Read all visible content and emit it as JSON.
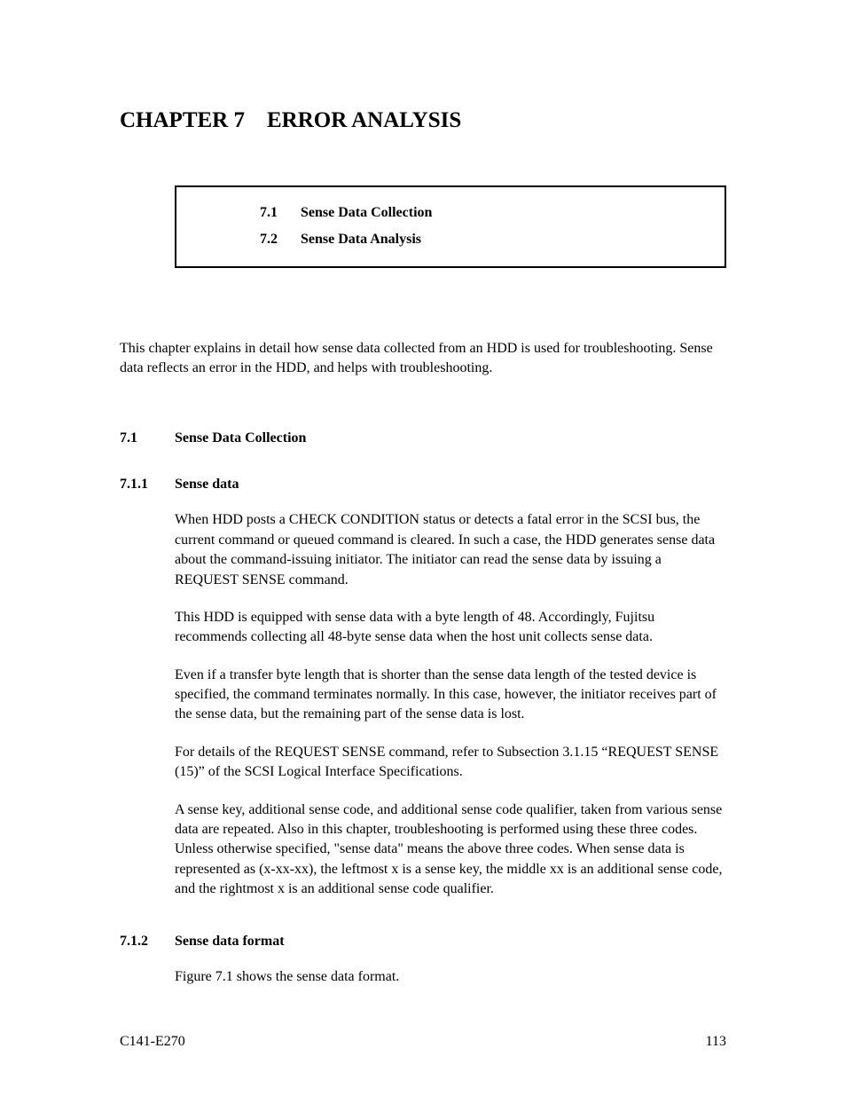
{
  "chapter_title": "CHAPTER 7 ERROR ANALYSIS",
  "toc": {
    "items": [
      {
        "num": "7.1",
        "label": "Sense Data Collection"
      },
      {
        "num": "7.2",
        "label": "Sense Data Analysis"
      }
    ]
  },
  "intro": "This chapter explains in detail how sense data collected from an HDD is used for troubleshooting.  Sense data reflects an error in the HDD, and helps with troubleshooting.",
  "sections": {
    "s7_1": {
      "num": "7.1",
      "title": "Sense Data Collection"
    },
    "s7_1_1": {
      "num": "7.1.1",
      "title": "Sense data",
      "p1": "When HDD posts a CHECK CONDITION status or detects a fatal error in the SCSI bus, the current command or queued command is cleared.  In such a case, the HDD generates sense data about the command-issuing initiator.  The initiator can read the sense data by issuing a REQUEST SENSE command.",
      "p2": "This HDD is equipped with sense data with a byte length of 48.  Accordingly, Fujitsu recommends collecting all 48-byte sense data when the host unit collects sense data.",
      "p3": "Even if a transfer byte length that is shorter than the sense data length of the tested device is specified, the command terminates normally.  In this case, however, the initiator receives part of the sense data, but the remaining part of the sense data is lost.",
      "p4": "For details of the REQUEST SENSE command, refer to Subsection 3.1.15 “REQUEST SENSE (15)” of the SCSI Logical Interface Specifications.",
      "p5": "A sense key, additional sense code, and additional sense code qualifier, taken from various sense data are repeated.  Also in this chapter, troubleshooting is performed using these three codes.  Unless otherwise specified, \"sense data\" means the above three codes.  When sense data is represented as (x-xx-xx), the leftmost x is a sense key, the middle xx is an additional sense code, and the rightmost x is an additional sense code qualifier."
    },
    "s7_1_2": {
      "num": "7.1.2",
      "title": "Sense data format",
      "p1": "Figure 7.1 shows the sense data format."
    }
  },
  "footer": {
    "left": "C141-E270",
    "right": "113"
  }
}
